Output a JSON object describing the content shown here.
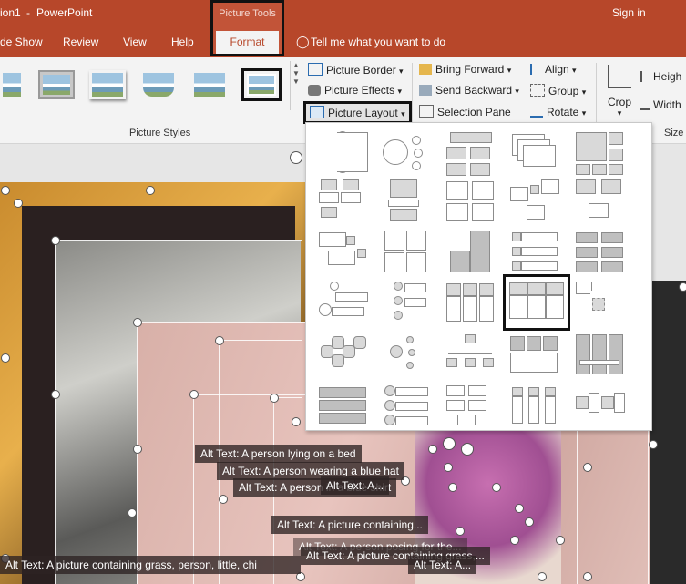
{
  "titlebar": {
    "doc_name": "ion1",
    "separator": "-",
    "app_name": "PowerPoint",
    "sign_in": "Sign in",
    "context_label": "Picture Tools",
    "context_tab": "Format",
    "tell_me": "Tell me what you want to do",
    "tabs": [
      "de Show",
      "Review",
      "View",
      "Help"
    ]
  },
  "ribbon": {
    "picture_styles_label": "Picture Styles",
    "size_label": "Size",
    "picture_border": "Picture Border",
    "picture_effects": "Picture Effects",
    "picture_layout": "Picture Layout",
    "bring_forward": "Bring Forward",
    "send_backward": "Send Backward",
    "selection_pane": "Selection Pane",
    "align": "Align",
    "group": "Group",
    "rotate": "Rotate",
    "crop": "Crop",
    "height": "Heigh",
    "width": "Width",
    "dropdown_glyph": "▾"
  },
  "slide": {
    "alt_texts": [
      "Alt Text: A person lying on a bed",
      "Alt Text: A person wearing a blue hat",
      "Alt Text: A person in a blue shirt",
      "Alt Text: A...",
      "Alt Text: A picture containing...",
      "Alt Text: A person posing for the...",
      "Alt Text: A picture containing grass,...",
      "Alt Text: A picture containing grass, person, little, chi",
      "Alt Text: A..."
    ]
  },
  "colors": {
    "accent": "#b7472a",
    "ribbon_bg": "#f3f3f3",
    "highlight_border": "#111111"
  }
}
